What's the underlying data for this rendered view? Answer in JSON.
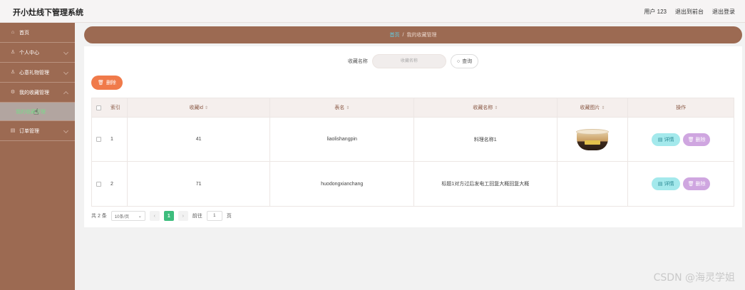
{
  "header": {
    "app_title": "开小灶线下管理系统",
    "user_label": "用户 123",
    "to_front_label": "退出到前台",
    "logout_label": "退出登录"
  },
  "sidebar": {
    "items": [
      {
        "label": "首页",
        "icon": "home-icon"
      },
      {
        "label": "个人中心",
        "icon": "user-icon"
      },
      {
        "label": "心意礼物管理",
        "icon": "user-icon"
      },
      {
        "label": "我的收藏管理",
        "icon": "settings-icon"
      },
      {
        "label": "订单管理",
        "icon": "order-icon"
      }
    ],
    "active_sub_label": "我的收藏管理"
  },
  "breadcrumb": {
    "home": "首页",
    "separator": "/",
    "current": "我的收藏管理"
  },
  "search": {
    "label": "收藏名称",
    "placeholder": "收藏名称",
    "button_label": "查询"
  },
  "toolbar": {
    "delete_label": "删除"
  },
  "table": {
    "headers": {
      "index": "索引",
      "id": "收藏id",
      "table": "表名",
      "name": "收藏名称",
      "image": "收藏图片",
      "ops": "操作"
    },
    "rows": [
      {
        "index": "1",
        "id": "41",
        "table": "liaolishangpin",
        "name": "料理名称1",
        "has_image": true
      },
      {
        "index": "2",
        "id": "71",
        "table": "huodongxianchang",
        "name": "标题1对方过后发电工回复大概回复大概",
        "has_image": false
      }
    ],
    "detail_label": "详情",
    "delete_label": "删除"
  },
  "pagination": {
    "total": "共 2 条",
    "page_size": "10条/页",
    "current_page": "1",
    "goto_label": "前往",
    "goto_value": "1",
    "page_suffix": "页"
  },
  "watermark": "CSDN @海灵学姐",
  "colors": {
    "sidebar": "#9c6a52",
    "accent_orange": "#f07a4a",
    "detail_btn": "#a4e9ec",
    "delete_btn": "#cfa6e0",
    "pager_active": "#3dbd7d"
  }
}
